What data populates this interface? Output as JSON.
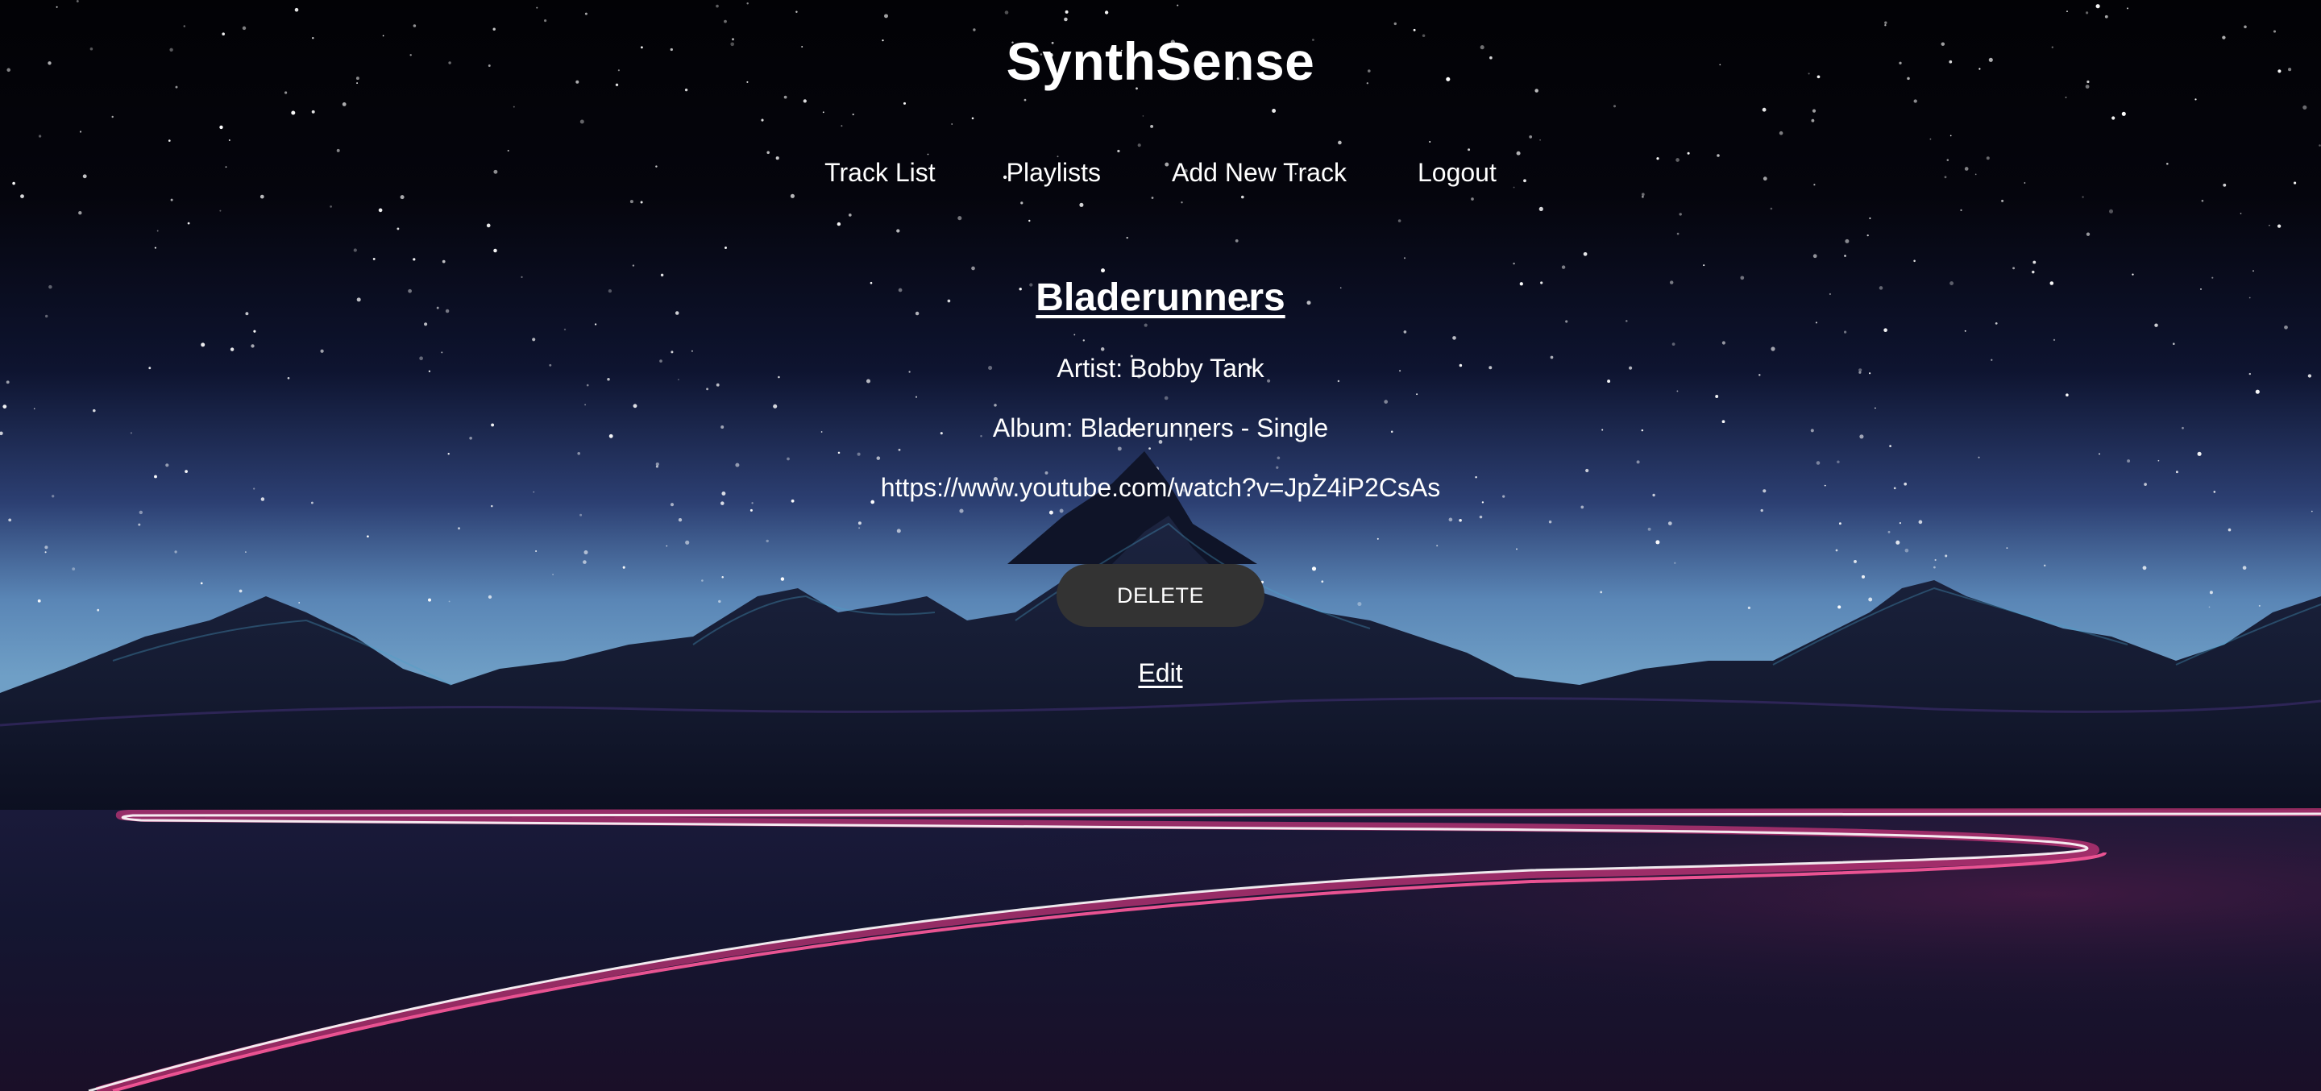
{
  "site": {
    "title": "SynthSense"
  },
  "nav": {
    "items": [
      {
        "label": "Track List"
      },
      {
        "label": "Playlists"
      },
      {
        "label": "Add New Track"
      },
      {
        "label": "Logout"
      }
    ]
  },
  "track": {
    "title": "Bladerunners",
    "artist": "Artist: Bobby Tank",
    "album": "Album: Bladerunners - Single",
    "url": "https://www.youtube.com/watch?v=JpZ4iP2CsAs"
  },
  "actions": {
    "delete_label": "DELETE",
    "edit_label": "Edit"
  },
  "colors": {
    "button_bg": "#333333",
    "text": "#ffffff",
    "sky_top": "#020205",
    "sky_horizon": "#6f9fc6",
    "road_pink": "#e8468a"
  }
}
